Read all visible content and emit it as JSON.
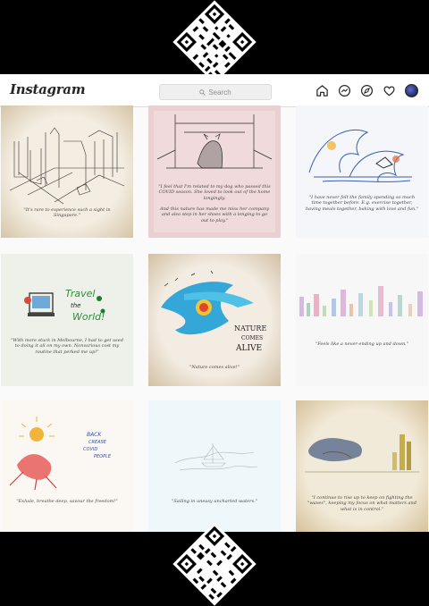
{
  "app": {
    "logo": "Instagram"
  },
  "search": {
    "placeholder": "Search"
  },
  "nav": {
    "icons": [
      "home-icon",
      "messenger-icon",
      "explore-icon",
      "heart-icon",
      "avatar"
    ]
  },
  "posts": [
    {
      "caption": "\"It's rare to experience such a sight in Singapore.\"",
      "bg": "#f3ede2"
    },
    {
      "caption": "\"I feel that I'm related to my dog who passed this COVID season. She loved to look out of the home longingly.\n\nAnd this nature has made me miss her company and also step in her shoes with a longing to go out to play.\"",
      "bg": "#ebd0d3"
    },
    {
      "caption": "\"I have never felt the family spending so much time together before. E.g. exercise together, having meals together, baking with love and fun.\"",
      "bg": "#f4f6f9"
    },
    {
      "caption": "\"With more stuck in Melbourne, I had to get used to doing it all on my own. Nonvarious cost my routine that perked me up!\"",
      "bg": "#eef1e9"
    },
    {
      "caption": "\"Nature comes alive!\"",
      "bg": "#f3ece2",
      "art_text": [
        "NATURE",
        "COMES",
        "ALIVE"
      ]
    },
    {
      "caption": "\"Feels like a never-ending up and down.\"",
      "bg": "#f8f7f7"
    },
    {
      "caption": "\"Exhale, breathe deep, savour the freedom!\"",
      "bg": "#fbf8f4",
      "art_text": [
        "BACK",
        "CREASE",
        "COVID",
        "PEOPLE"
      ]
    },
    {
      "caption": "\"Sailing in uneasy uncharted waters.\"",
      "bg": "#eef8fb"
    },
    {
      "caption": "\"I continue to rise up to keep on fighting the \"waves\", keeping my focus on what matters and what is in control.\"",
      "bg": "#f2ead9"
    }
  ],
  "post3_art_text": [
    "Travel",
    "the",
    "World!"
  ]
}
